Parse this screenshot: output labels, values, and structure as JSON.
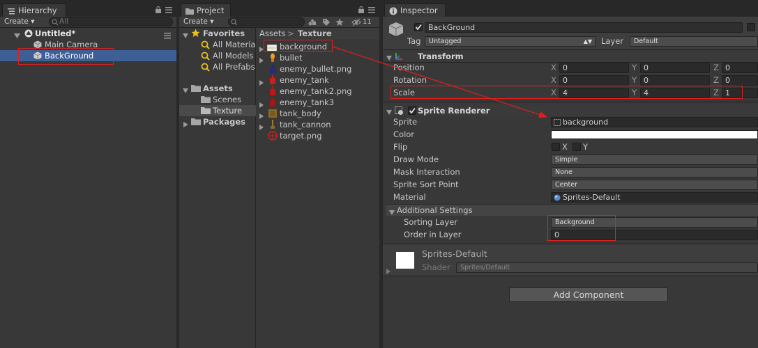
{
  "hierarchy": {
    "tab_label": "Hierarchy",
    "create_label": "Create",
    "search_placeholder": "All",
    "scene_name": "Untitled*",
    "items": [
      {
        "label": "Main Camera"
      },
      {
        "label": "BackGround"
      }
    ]
  },
  "project": {
    "tab_label": "Project",
    "create_label": "Create",
    "hidden_count": "11",
    "favorites": {
      "label": "Favorites",
      "items": [
        "All Materia",
        "All Models",
        "All Prefabs"
      ]
    },
    "assets": {
      "label": "Assets",
      "folders": [
        "Scenes",
        "Texture"
      ]
    },
    "packages_label": "Packages",
    "breadcrumb": {
      "root": "Assets",
      "separator": ">",
      "current": "Texture"
    },
    "files": [
      {
        "name": "background",
        "icon": "background-sprite-icon"
      },
      {
        "name": "bullet",
        "icon": "bullet-sprite-icon"
      },
      {
        "name": "enemy_bullet.png",
        "icon": "enemy-bullet-sprite-icon"
      },
      {
        "name": "enemy_tank",
        "icon": "enemy-tank-sprite-icon"
      },
      {
        "name": "enemy_tank2.png",
        "icon": "enemy-tank2-sprite-icon"
      },
      {
        "name": "enemy_tank3",
        "icon": "enemy-tank3-sprite-icon"
      },
      {
        "name": "tank_body",
        "icon": "tank-body-sprite-icon"
      },
      {
        "name": "tank_cannon",
        "icon": "tank-cannon-sprite-icon"
      },
      {
        "name": "target.png",
        "icon": "target-sprite-icon"
      }
    ]
  },
  "inspector": {
    "tab_label": "Inspector",
    "object_name": "BackGround",
    "tag_label": "Tag",
    "tag_value": "Untagged",
    "layer_label": "Layer",
    "layer_value": "Default",
    "transform": {
      "title": "Transform",
      "position": {
        "label": "Position",
        "x": "0",
        "y": "0",
        "z": "0"
      },
      "rotation": {
        "label": "Rotation",
        "x": "0",
        "y": "0",
        "z": "0"
      },
      "scale": {
        "label": "Scale",
        "x": "4",
        "y": "4",
        "z": "1"
      },
      "axis_x": "X",
      "axis_y": "Y",
      "axis_z": "Z"
    },
    "sprite_renderer": {
      "title": "Sprite Renderer",
      "sprite_label": "Sprite",
      "sprite_value": "background",
      "color_label": "Color",
      "color_value": "#ffffff",
      "flip_label": "Flip",
      "flip_x": "X",
      "flip_y": "Y",
      "draw_mode_label": "Draw Mode",
      "draw_mode_value": "Simple",
      "mask_label": "Mask Interaction",
      "mask_value": "None",
      "sort_point_label": "Sprite Sort Point",
      "sort_point_value": "Center",
      "material_label": "Material",
      "material_value": "Sprites-Default",
      "additional_title": "Additional Settings",
      "sorting_layer_label": "Sorting Layer",
      "sorting_layer_value": "Background",
      "order_label": "Order in Layer",
      "order_value": "0"
    },
    "material_preview": {
      "name": "Sprites-Default",
      "shader_label": "Shader",
      "shader_value": "Sprites/Default"
    },
    "add_component_label": "Add Component"
  },
  "colors": {
    "panel_bg": "#383838",
    "selection": "#3e5f96",
    "annotation_red": "#e02020",
    "folder": "#a6a6a6",
    "favorites_star": "#f0c020"
  }
}
